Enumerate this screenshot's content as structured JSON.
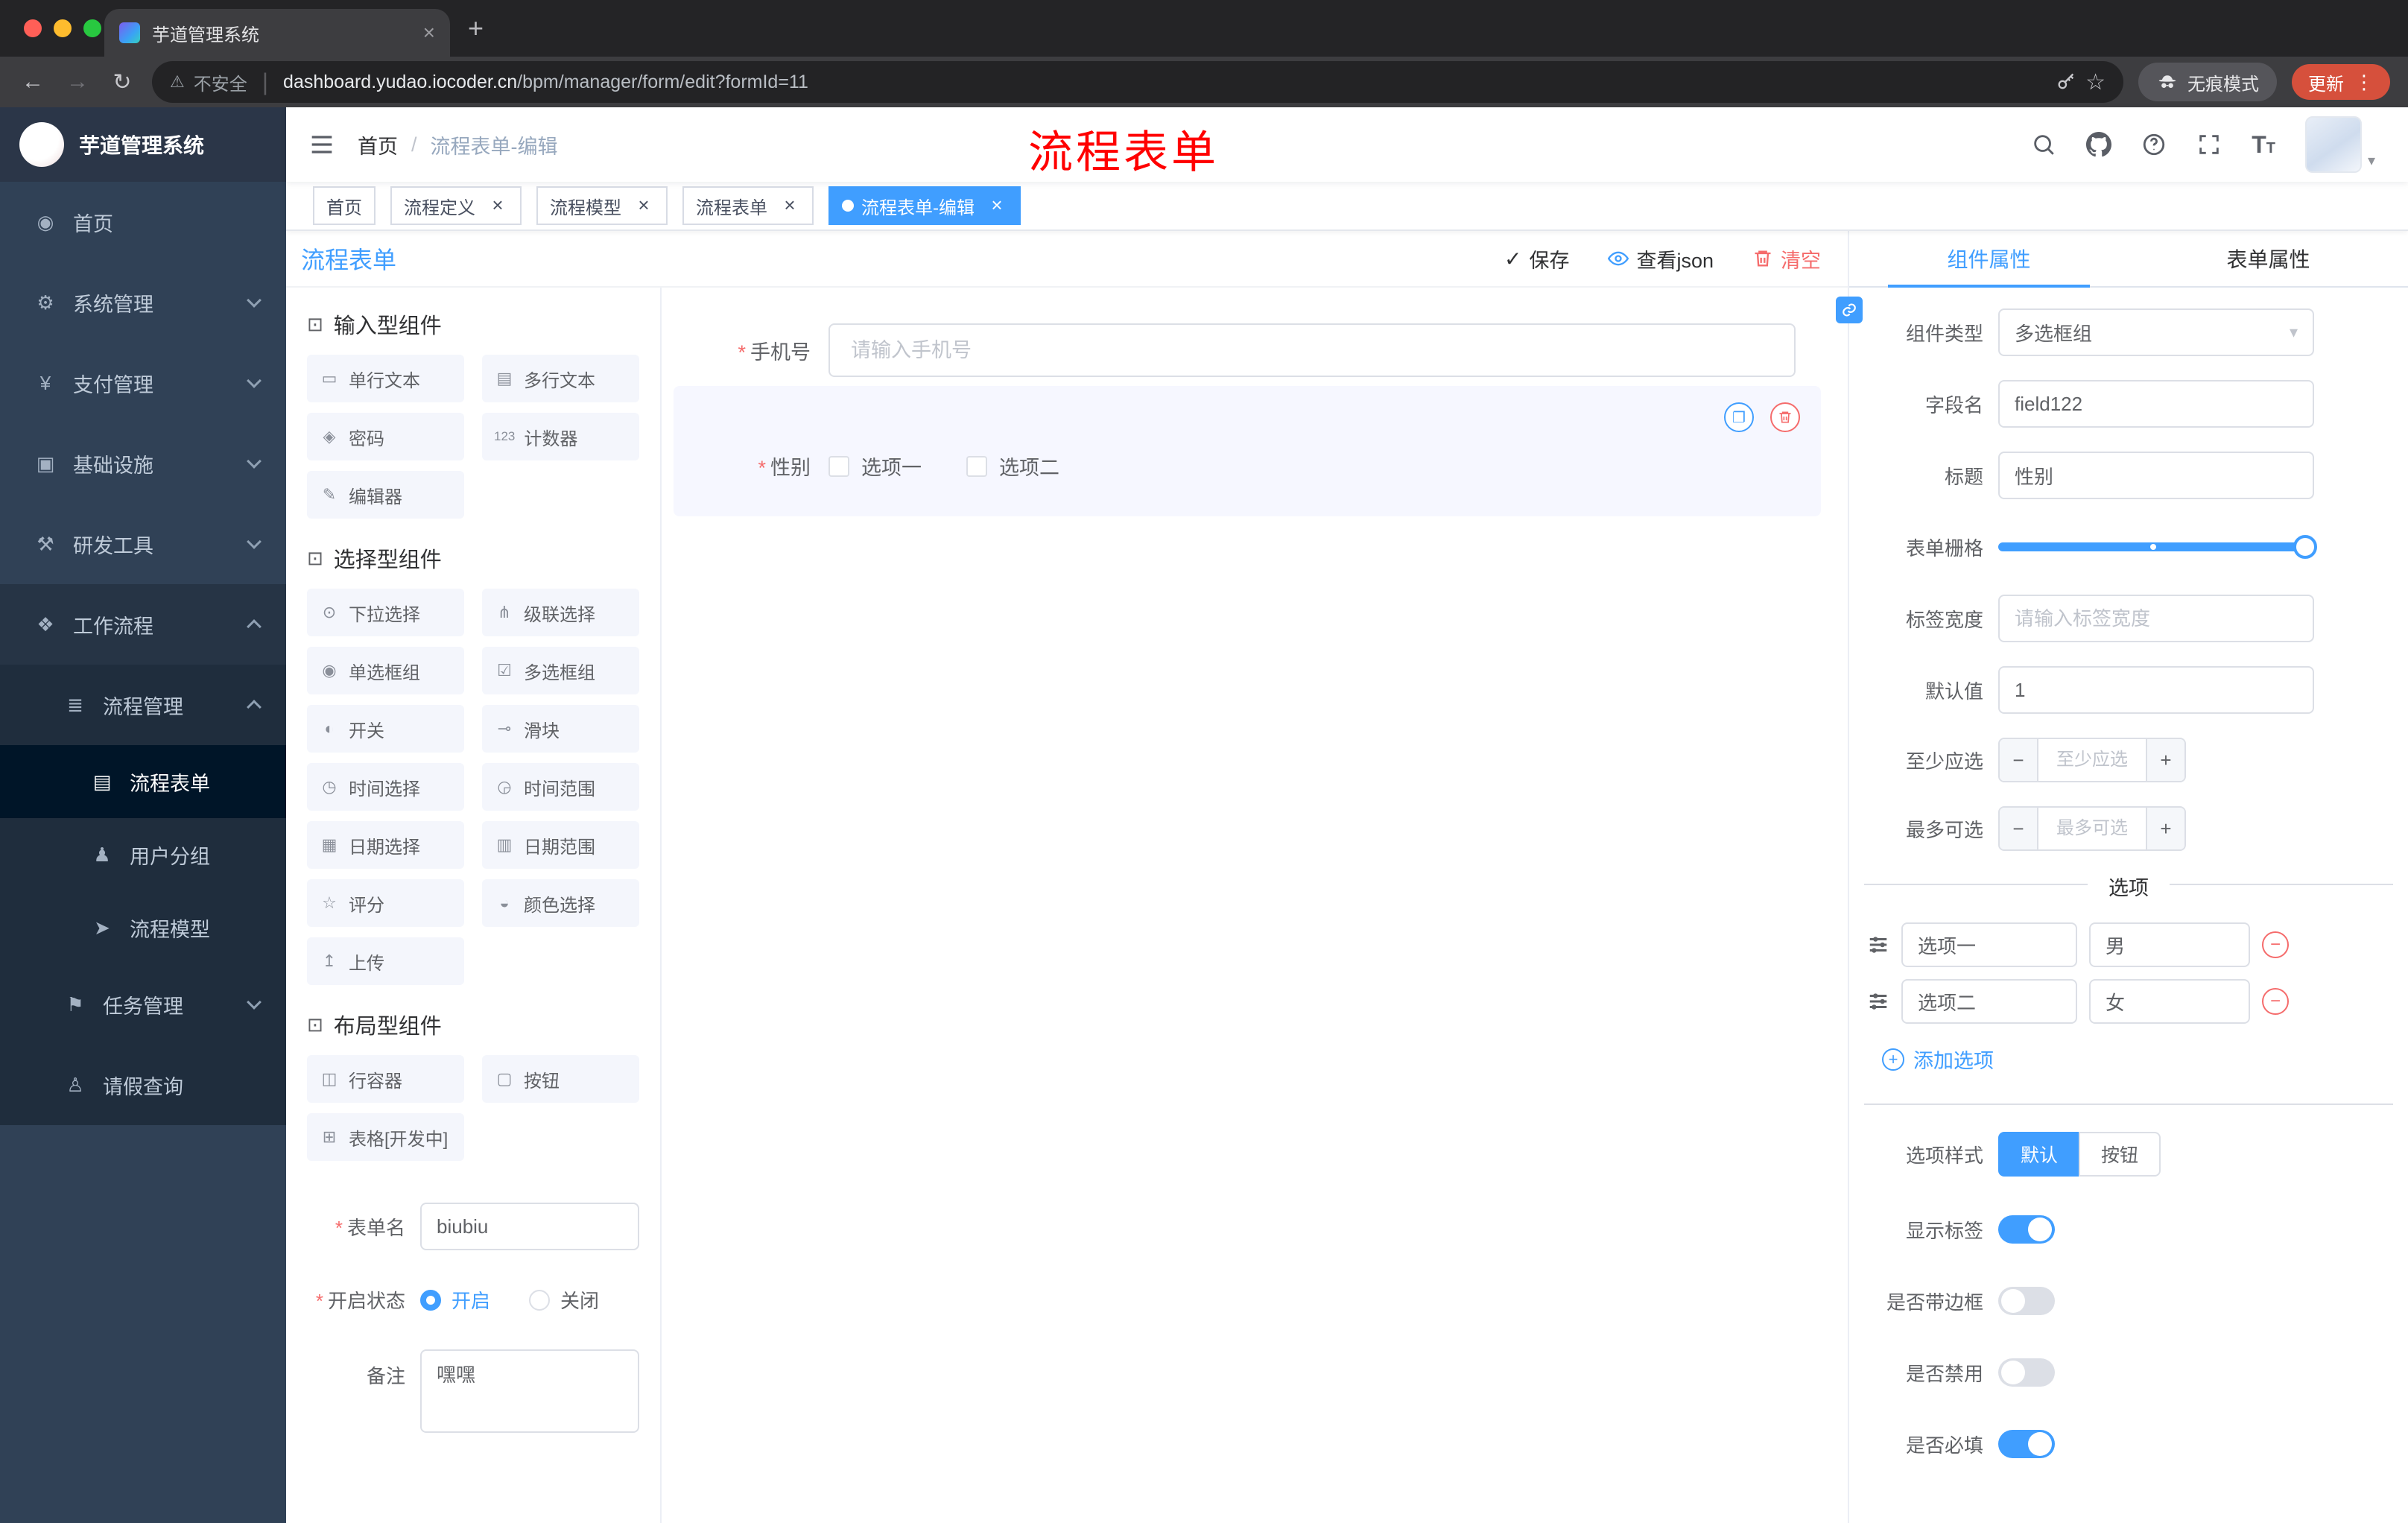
{
  "colors": {
    "accent": "#409EFF",
    "danger": "#F56C6C",
    "annotation": "#FF0000",
    "sidebar_bg": "#304156",
    "submenu_bg": "#1F2D3D",
    "active_bg": "#001528"
  },
  "browser": {
    "tab": {
      "title": "芋道管理系统"
    },
    "security_label": "不安全",
    "url_host": "dashboard.yudao.iocoder.cn",
    "url_path": "/bpm/manager/form/edit?formId=11",
    "incognito_label": "无痕模式",
    "update_label": "更新"
  },
  "sidebar": {
    "logo_title": "芋道管理系统",
    "items": [
      {
        "label": "首页",
        "icon": "dashboard-icon",
        "level": 1
      },
      {
        "label": "系统管理",
        "icon": "gear-icon",
        "level": 1,
        "chevron": "down"
      },
      {
        "label": "支付管理",
        "icon": "payment-icon",
        "level": 1,
        "chevron": "down"
      },
      {
        "label": "基础设施",
        "icon": "infrastructure-icon",
        "level": 1,
        "chevron": "down"
      },
      {
        "label": "研发工具",
        "icon": "dev-tools-icon",
        "level": 1,
        "chevron": "down"
      },
      {
        "label": "工作流程",
        "icon": "workflow-icon",
        "level": 1,
        "chevron": "up",
        "open": true
      },
      {
        "label": "流程管理",
        "icon": "process-manage-icon",
        "level": 2,
        "chevron": "up",
        "open": true
      },
      {
        "label": "流程表单",
        "icon": "process-form-icon",
        "level": 3,
        "active": true
      },
      {
        "label": "用户分组",
        "icon": "user-group-icon",
        "level": 3
      },
      {
        "label": "流程模型",
        "icon": "process-model-icon",
        "level": 3
      },
      {
        "label": "任务管理",
        "icon": "task-manage-icon",
        "level": 2,
        "chevron": "down"
      },
      {
        "label": "请假查询",
        "icon": "leave-query-icon",
        "level": 2
      }
    ]
  },
  "header": {
    "breadcrumb_home": "首页",
    "breadcrumb_sep": "/",
    "breadcrumb_current": "流程表单-编辑",
    "annotation": "流程表单"
  },
  "tags": [
    {
      "label": "首页",
      "closable": false,
      "active": false
    },
    {
      "label": "流程定义",
      "closable": true,
      "active": false
    },
    {
      "label": "流程模型",
      "closable": true,
      "active": false
    },
    {
      "label": "流程表单",
      "closable": true,
      "active": false
    },
    {
      "label": "流程表单-编辑",
      "closable": true,
      "active": true
    }
  ],
  "designer": {
    "title": "流程表单",
    "required_mark": "*",
    "actions": {
      "save": "保存",
      "view_json": "查看json",
      "clear": "清空"
    },
    "palette": {
      "groups": [
        {
          "title": "输入型组件",
          "items": [
            {
              "label": "单行文本",
              "icon": "single-line-text-icon"
            },
            {
              "label": "多行文本",
              "icon": "multi-line-text-icon"
            },
            {
              "label": "密码",
              "icon": "password-icon"
            },
            {
              "label": "计数器",
              "icon": "counter-icon"
            },
            {
              "label": "编辑器",
              "icon": "editor-icon"
            }
          ]
        },
        {
          "title": "选择型组件",
          "items": [
            {
              "label": "下拉选择",
              "icon": "select-icon"
            },
            {
              "label": "级联选择",
              "icon": "cascader-icon"
            },
            {
              "label": "单选框组",
              "icon": "radio-group-icon"
            },
            {
              "label": "多选框组",
              "icon": "checkbox-group-icon"
            },
            {
              "label": "开关",
              "icon": "switch-icon"
            },
            {
              "label": "滑块",
              "icon": "slider-icon"
            },
            {
              "label": "时间选择",
              "icon": "time-picker-icon"
            },
            {
              "label": "时间范围",
              "icon": "time-range-icon"
            },
            {
              "label": "日期选择",
              "icon": "date-picker-icon"
            },
            {
              "label": "日期范围",
              "icon": "date-range-icon"
            },
            {
              "label": "评分",
              "icon": "rate-icon"
            },
            {
              "label": "颜色选择",
              "icon": "color-picker-icon"
            },
            {
              "label": "上传",
              "icon": "upload-icon"
            }
          ]
        },
        {
          "title": "布局型组件",
          "items": [
            {
              "label": "行容器",
              "icon": "row-container-icon"
            },
            {
              "label": "按钮",
              "icon": "button-icon"
            },
            {
              "label": "表格[开发中]",
              "icon": "table-icon"
            }
          ]
        }
      ],
      "form": {
        "name_label": "表单名",
        "name_value": "biubiu",
        "status_label": "开启状态",
        "status_options": [
          {
            "label": "开启",
            "selected": true
          },
          {
            "label": "关闭",
            "selected": false
          }
        ],
        "remark_label": "备注",
        "remark_value": "嘿嘿"
      }
    },
    "canvas": {
      "fields": [
        {
          "type": "input",
          "required": true,
          "label": "手机号",
          "placeholder": "请输入手机号"
        },
        {
          "type": "checkbox-group",
          "required": true,
          "label": "性别",
          "options": [
            "选项一",
            "选项二"
          ],
          "selected": true
        }
      ]
    },
    "props": {
      "tab_component": "组件属性",
      "tab_form": "表单属性",
      "rows": {
        "component_type": {
          "label": "组件类型",
          "value": "多选框组"
        },
        "field_name": {
          "label": "字段名",
          "value": "field122"
        },
        "title": {
          "label": "标题",
          "value": "性别"
        },
        "grid": {
          "label": "表单栅格"
        },
        "label_width": {
          "label": "标签宽度",
          "placeholder": "请输入标签宽度"
        },
        "default_value": {
          "label": "默认值",
          "value": "1"
        },
        "min_select": {
          "label": "至少应选",
          "placeholder": "至少应选"
        },
        "max_select": {
          "label": "最多可选",
          "placeholder": "最多可选"
        }
      },
      "options_section": {
        "divider": "选项",
        "options": [
          {
            "label": "选项一",
            "value": "男"
          },
          {
            "label": "选项二",
            "value": "女"
          }
        ],
        "add_label": "添加选项"
      },
      "style_row": {
        "label": "选项样式",
        "buttons": [
          {
            "label": "默认",
            "active": true
          },
          {
            "label": "按钮",
            "active": false
          }
        ]
      },
      "switch_rows": [
        {
          "label": "显示标签",
          "on": true
        },
        {
          "label": "是否带边框",
          "on": false
        },
        {
          "label": "是否禁用",
          "on": false
        },
        {
          "label": "是否必填",
          "on": true
        }
      ]
    }
  },
  "icons": {
    "tab-close-icon": "×",
    "new-tab-icon": "+",
    "back-icon": "←",
    "forward-icon": "→",
    "reload-icon": "↻",
    "warning-icon": "⚠",
    "bookmark-star-icon": "☆",
    "menu-dots-icon": "⋮",
    "dashboard-icon": "◉",
    "gear-icon": "⚙",
    "payment-icon": "¥",
    "infrastructure-icon": "▣",
    "dev-tools-icon": "⚒",
    "workflow-icon": "❖",
    "process-manage-icon": "≣",
    "process-form-icon": "▤",
    "user-group-icon": "♟",
    "process-model-icon": "➤",
    "task-manage-icon": "⚑",
    "leave-query-icon": "♙",
    "component-group-icon": "⊡",
    "single-line-text-icon": "▭",
    "multi-line-text-icon": "▤",
    "password-icon": "◈",
    "counter-icon": "123",
    "editor-icon": "✎",
    "select-icon": "⊙",
    "cascader-icon": "⋔",
    "radio-group-icon": "◉",
    "checkbox-group-icon": "☑",
    "switch-icon": "◐",
    "slider-icon": "⊸",
    "time-picker-icon": "◷",
    "time-range-icon": "◶",
    "date-picker-icon": "▦",
    "date-range-icon": "▥",
    "rate-icon": "☆",
    "color-picker-icon": "◒",
    "upload-icon": "↥",
    "row-container-icon": "◫",
    "button-icon": "▢",
    "table-icon": "⊞",
    "check-icon": "✓",
    "copy-icon": "❐",
    "minus-icon": "−",
    "plus-icon": "+",
    "select-arrow-icon": "▾",
    "caret-down-icon": "▾",
    "font-size-icon": "T"
  }
}
